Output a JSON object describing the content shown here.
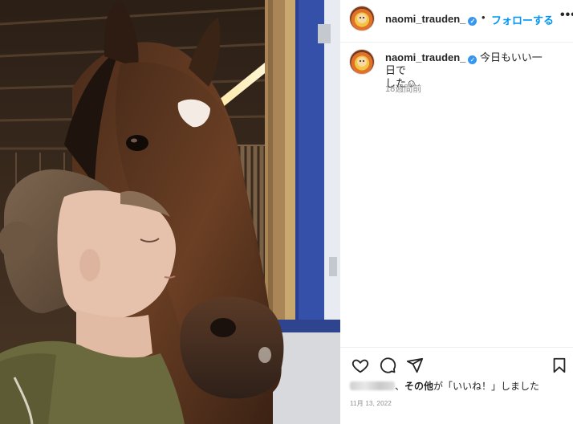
{
  "post": {
    "username": "naomi_trauden_",
    "separator": "•",
    "follow_label": "フォローする",
    "more_label": "•••",
    "caption_text_line1": "今日もいい一日で",
    "caption_text_line2": "した☺",
    "time_ago": "18週間前",
    "likes_text_suffix": "、その他が「いいね！」しました",
    "likes_other": "その他",
    "date": "11月 13, 2022"
  },
  "icons": {
    "like": "heart-icon",
    "comment": "comment-icon",
    "share": "share-icon",
    "save": "bookmark-icon",
    "verified": "verified-badge-icon"
  },
  "colors": {
    "follow": "#0095f6",
    "verified": "#3797f0",
    "muted": "#8e8e8e",
    "text": "#262626"
  }
}
